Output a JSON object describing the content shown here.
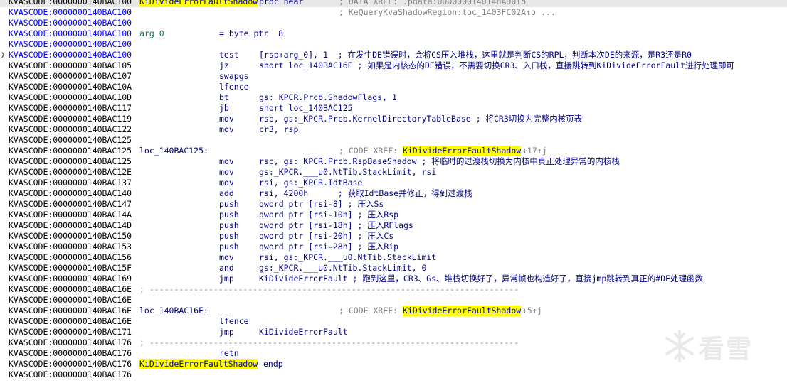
{
  "listing": [
    {
      "addr": "KVASCODE:0000000140BAC100",
      "blue": false,
      "selected": true,
      "parts": [
        {
          "col": 196,
          "text": "KiDivideErrorFaultShadow",
          "cls": "hl"
        },
        {
          "col": 364,
          "text": "proc near",
          "cls": "kw"
        },
        {
          "col": 476,
          "text": "; DATA XREF: .pdata:0000000140148AD0↑o",
          "cls": "xref"
        }
      ]
    },
    {
      "addr": "KVASCODE:0000000140BAC100",
      "blue": true,
      "parts": [
        {
          "col": 476,
          "text": "; KeQueryKvaShadowRegion:loc_1403FC02A↑o ...",
          "cls": "xref"
        }
      ]
    },
    {
      "addr": "KVASCODE:0000000140BAC100",
      "blue": true,
      "parts": []
    },
    {
      "addr": "KVASCODE:0000000140BAC100",
      "blue": true,
      "parts": [
        {
          "col": 196,
          "text": "arg_0",
          "cls": "var"
        },
        {
          "col": 308,
          "text": "= byte ptr  8",
          "cls": "kw"
        }
      ]
    },
    {
      "addr": "KVASCODE:0000000140BAC100",
      "blue": true,
      "parts": []
    },
    {
      "addr": "KVASCODE:0000000140BAC100",
      "blue": true,
      "marker": "❯",
      "parts": [
        {
          "col": 308,
          "text": "test",
          "cls": "kw"
        },
        {
          "col": 364,
          "text": "[rsp+arg_0], 1  ; 在发生DE错误时，会将CS压入堆栈，这里就是判断CS的RPL，判断本次DE的来源，是R3还是R0",
          "cls": "kw"
        }
      ]
    },
    {
      "addr": "KVASCODE:0000000140BAC105",
      "blue": false,
      "parts": [
        {
          "col": 308,
          "text": "jz",
          "cls": "kw"
        },
        {
          "col": 364,
          "text": "short loc_140BAC16E ; 如果是内核态的DE错误，不需要切换CR3、入口栈，直接跳转到KiDivideErrorFault进行处理即可",
          "cls": "kw"
        }
      ]
    },
    {
      "addr": "KVASCODE:0000000140BAC107",
      "blue": false,
      "parts": [
        {
          "col": 308,
          "text": "swapgs",
          "cls": "kw"
        }
      ]
    },
    {
      "addr": "KVASCODE:0000000140BAC10A",
      "blue": false,
      "parts": [
        {
          "col": 308,
          "text": "lfence",
          "cls": "kw"
        }
      ]
    },
    {
      "addr": "KVASCODE:0000000140BAC10D",
      "blue": false,
      "parts": [
        {
          "col": 308,
          "text": "bt",
          "cls": "kw"
        },
        {
          "col": 364,
          "text": "gs:_KPCR.Prcb.ShadowFlags, 1",
          "cls": "kw"
        }
      ]
    },
    {
      "addr": "KVASCODE:0000000140BAC117",
      "blue": false,
      "parts": [
        {
          "col": 308,
          "text": "jb",
          "cls": "kw"
        },
        {
          "col": 364,
          "text": "short loc_140BAC125",
          "cls": "kw"
        }
      ]
    },
    {
      "addr": "KVASCODE:0000000140BAC119",
      "blue": false,
      "parts": [
        {
          "col": 308,
          "text": "mov",
          "cls": "kw"
        },
        {
          "col": 364,
          "text": "rsp, gs:_KPCR.Prcb.KernelDirectoryTableBase ; 将CR3切换为完整内核页表",
          "cls": "kw"
        }
      ]
    },
    {
      "addr": "KVASCODE:0000000140BAC122",
      "blue": false,
      "parts": [
        {
          "col": 308,
          "text": "mov",
          "cls": "kw"
        },
        {
          "col": 364,
          "text": "cr3, rsp",
          "cls": "kw"
        }
      ]
    },
    {
      "addr": "KVASCODE:0000000140BAC125",
      "blue": false,
      "parts": []
    },
    {
      "addr": "KVASCODE:0000000140BAC125",
      "blue": false,
      "parts": [
        {
          "col": 196,
          "text": "loc_140BAC125:",
          "cls": "kw"
        },
        {
          "col": 476,
          "text": "; CODE XREF: ",
          "cls": "xref"
        },
        {
          "col": 566,
          "text": "KiDivideErrorFaultShadow",
          "cls": "hl"
        },
        {
          "col": 734,
          "text": "+17↑j",
          "cls": "xref"
        }
      ]
    },
    {
      "addr": "KVASCODE:0000000140BAC125",
      "blue": false,
      "parts": [
        {
          "col": 308,
          "text": "mov",
          "cls": "kw"
        },
        {
          "col": 364,
          "text": "rsp, gs:_KPCR.Prcb.RspBaseShadow ; 将临时的过渡栈切换为内核中真正处理异常的内核栈",
          "cls": "kw"
        }
      ]
    },
    {
      "addr": "KVASCODE:0000000140BAC12E",
      "blue": false,
      "parts": [
        {
          "col": 308,
          "text": "mov",
          "cls": "kw"
        },
        {
          "col": 364,
          "text": "gs:_KPCR.___u0.NtTib.StackLimit, rsi",
          "cls": "kw"
        }
      ]
    },
    {
      "addr": "KVASCODE:0000000140BAC137",
      "blue": false,
      "parts": [
        {
          "col": 308,
          "text": "mov",
          "cls": "kw"
        },
        {
          "col": 364,
          "text": "rsi, gs:_KPCR.IdtBase",
          "cls": "kw"
        }
      ]
    },
    {
      "addr": "KVASCODE:0000000140BAC140",
      "blue": false,
      "parts": [
        {
          "col": 308,
          "text": "add",
          "cls": "kw"
        },
        {
          "col": 364,
          "text": "rsi, 4200h      ; 获取IdtBase并修正，得到过渡栈",
          "cls": "kw"
        }
      ]
    },
    {
      "addr": "KVASCODE:0000000140BAC147",
      "blue": false,
      "parts": [
        {
          "col": 308,
          "text": "push",
          "cls": "kw"
        },
        {
          "col": 364,
          "text": "qword ptr [rsi-8] ; 压入Ss",
          "cls": "kw"
        }
      ]
    },
    {
      "addr": "KVASCODE:0000000140BAC14A",
      "blue": false,
      "parts": [
        {
          "col": 308,
          "text": "push",
          "cls": "kw"
        },
        {
          "col": 364,
          "text": "qword ptr [rsi-10h] ; 压入Rsp",
          "cls": "kw"
        }
      ]
    },
    {
      "addr": "KVASCODE:0000000140BAC14D",
      "blue": false,
      "parts": [
        {
          "col": 308,
          "text": "push",
          "cls": "kw"
        },
        {
          "col": 364,
          "text": "qword ptr [rsi-18h] ; 压入RFlags",
          "cls": "kw"
        }
      ]
    },
    {
      "addr": "KVASCODE:0000000140BAC150",
      "blue": false,
      "parts": [
        {
          "col": 308,
          "text": "push",
          "cls": "kw"
        },
        {
          "col": 364,
          "text": "qword ptr [rsi-20h] ; 压入Cs",
          "cls": "kw"
        }
      ]
    },
    {
      "addr": "KVASCODE:0000000140BAC153",
      "blue": false,
      "parts": [
        {
          "col": 308,
          "text": "push",
          "cls": "kw"
        },
        {
          "col": 364,
          "text": "qword ptr [rsi-28h] ; 压入Rip",
          "cls": "kw"
        }
      ]
    },
    {
      "addr": "KVASCODE:0000000140BAC156",
      "blue": false,
      "parts": [
        {
          "col": 308,
          "text": "mov",
          "cls": "kw"
        },
        {
          "col": 364,
          "text": "rsi, gs:_KPCR.___u0.NtTib.StackLimit",
          "cls": "kw"
        }
      ]
    },
    {
      "addr": "KVASCODE:0000000140BAC15F",
      "blue": false,
      "parts": [
        {
          "col": 308,
          "text": "and",
          "cls": "kw"
        },
        {
          "col": 364,
          "text": "gs:_KPCR.___u0.NtTib.StackLimit, 0",
          "cls": "kw"
        }
      ]
    },
    {
      "addr": "KVASCODE:0000000140BAC169",
      "blue": false,
      "parts": [
        {
          "col": 308,
          "text": "jmp",
          "cls": "kw"
        },
        {
          "col": 364,
          "text": "KiDivideErrorFault ; 跑到这里，CR3、Gs、堆栈切换好了，异常帧也构造好了，直接jmp跳转到真正的#DE处理函数",
          "cls": "kw"
        }
      ]
    },
    {
      "addr": "KVASCODE:0000000140BAC16E",
      "blue": false,
      "parts": [
        {
          "col": 196,
          "text": "; ---------------------------------------------------------------------------",
          "cls": "sep"
        }
      ]
    },
    {
      "addr": "KVASCODE:0000000140BAC16E",
      "blue": false,
      "parts": []
    },
    {
      "addr": "KVASCODE:0000000140BAC16E",
      "blue": false,
      "parts": [
        {
          "col": 196,
          "text": "loc_140BAC16E:",
          "cls": "kw"
        },
        {
          "col": 476,
          "text": "; CODE XREF: ",
          "cls": "xref"
        },
        {
          "col": 566,
          "text": "KiDivideErrorFaultShadow",
          "cls": "hl"
        },
        {
          "col": 734,
          "text": "+5↑j",
          "cls": "xref"
        }
      ]
    },
    {
      "addr": "KVASCODE:0000000140BAC16E",
      "blue": false,
      "parts": [
        {
          "col": 308,
          "text": "lfence",
          "cls": "kw"
        }
      ]
    },
    {
      "addr": "KVASCODE:0000000140BAC171",
      "blue": false,
      "parts": [
        {
          "col": 308,
          "text": "jmp",
          "cls": "kw"
        },
        {
          "col": 364,
          "text": "KiDivideErrorFault",
          "cls": "kw"
        }
      ]
    },
    {
      "addr": "KVASCODE:0000000140BAC176",
      "blue": false,
      "parts": [
        {
          "col": 196,
          "text": "; ---------------------------------------------------------------------------",
          "cls": "sep"
        }
      ]
    },
    {
      "addr": "KVASCODE:0000000140BAC176",
      "blue": false,
      "parts": [
        {
          "col": 308,
          "text": "retn",
          "cls": "kw"
        }
      ]
    },
    {
      "addr": "KVASCODE:0000000140BAC176",
      "blue": false,
      "parts": [
        {
          "col": 196,
          "text": "KiDivideErrorFaultShadow",
          "cls": "hl"
        },
        {
          "col": 370,
          "text": "endp",
          "cls": "kw"
        }
      ]
    },
    {
      "addr": "KVASCODE:0000000140BAC176",
      "blue": false,
      "parts": []
    }
  ],
  "watermark": {
    "text": "看雪",
    "icon": "snowflake-icon"
  }
}
